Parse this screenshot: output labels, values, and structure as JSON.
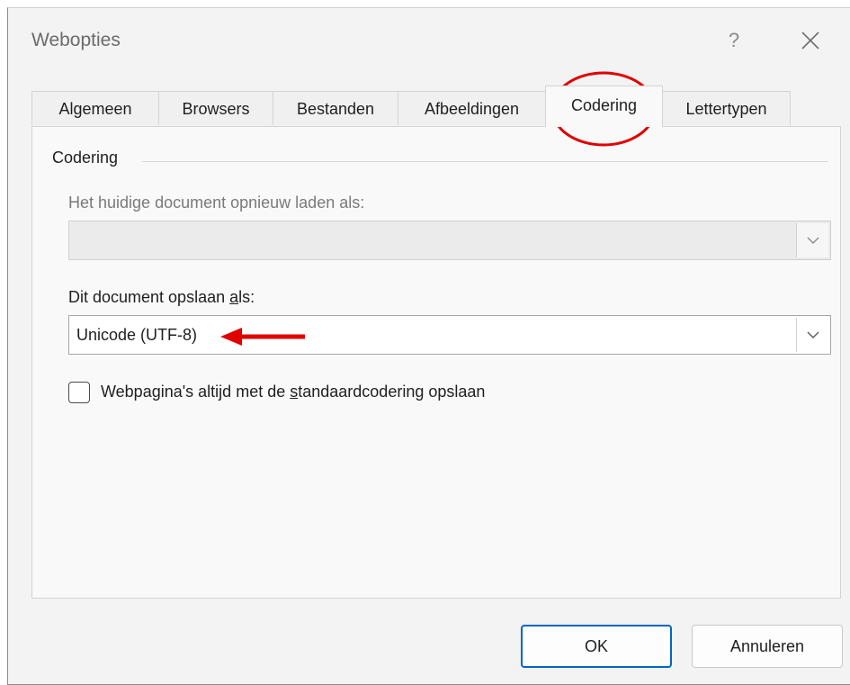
{
  "window": {
    "title": "Webopties",
    "help_label": "?"
  },
  "tabs": [
    {
      "label": "Algemeen",
      "active": false
    },
    {
      "label": "Browsers",
      "active": false
    },
    {
      "label": "Bestanden",
      "active": false
    },
    {
      "label": "Afbeeldingen",
      "active": false
    },
    {
      "label": "Codering",
      "active": true
    },
    {
      "label": "Lettertypen",
      "active": false
    }
  ],
  "encoding": {
    "group_label": "Codering",
    "reload_label": "Het huidige document opnieuw laden als:",
    "reload_value": "",
    "save_label_prefix": "Dit document opslaan ",
    "save_label_accel": "a",
    "save_label_suffix": "ls:",
    "save_value": "Unicode (UTF-8)",
    "checkbox_prefix": "Webpagina's altijd met de ",
    "checkbox_accel": "s",
    "checkbox_suffix": "tandaardcodering opslaan",
    "checkbox_checked": false
  },
  "buttons": {
    "ok": "OK",
    "cancel": "Annuleren"
  },
  "icons": {
    "close": "close-icon",
    "dropdown": "chevron-down-icon"
  },
  "annotation_color": "#e00000",
  "accent_color": "#0067c0"
}
